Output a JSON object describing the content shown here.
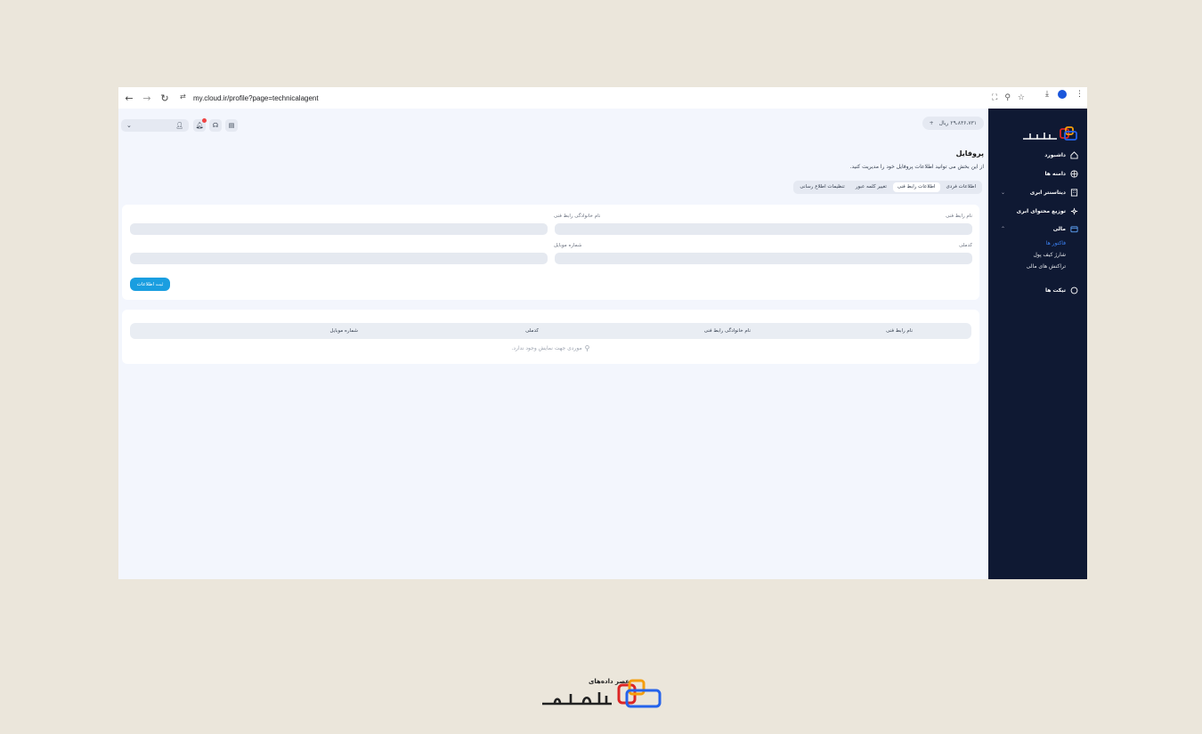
{
  "browser": {
    "url": "my.cloud.ir/profile?page=technicalagent"
  },
  "sidebar": {
    "items": [
      {
        "label": "داشبورد",
        "icon": "home-icon"
      },
      {
        "label": "دامنه ها",
        "icon": "globe-icon"
      },
      {
        "label": "دیتاسنتر ابری",
        "icon": "building-icon"
      },
      {
        "label": "توزیع محتوای ابری",
        "icon": "cdn-icon"
      },
      {
        "label": "مالی",
        "icon": "wallet-icon"
      },
      {
        "label": "تیکت ها",
        "icon": "chat-icon"
      }
    ],
    "finance_sub": [
      "فاکتور ها",
      "شارژ کیف پول",
      "تراکنش های مالی"
    ]
  },
  "header": {
    "balance": "۲۹،۸۳۶،۷۳۱ ریال",
    "balance_plus": "+"
  },
  "page": {
    "title": "پروفایل",
    "subtitle": "از این بخش می توانید اطلاعات پروفایل خود را مدیریت کنید."
  },
  "tabs": [
    "اطلاعات فردی",
    "اطلاعات رابط فنی",
    "تغییر کلمه عبور",
    "تنظیمات اطلاع رسانی"
  ],
  "form": {
    "first_name_label": "نام رابط فنی",
    "last_name_label": "نام خانوادگی رابط فنی",
    "national_code_label": "کدملی",
    "mobile_label": "شماره موبایل",
    "submit_label": "ثبت اطلاعات"
  },
  "table": {
    "headers": [
      "نام رابط فنی",
      "نام خانوادگی رابط فنی",
      "کدملی",
      "شماره موبایل"
    ],
    "empty_text": "موردی جهت نمایش وجود ندارد."
  },
  "footer": {
    "tagline": "عصر داده‌های"
  },
  "colors": {
    "sidebar_bg": "#0f1933",
    "accent": "#1a9ee0",
    "active_sub": "#3b82f6",
    "logo_orange": "#f59e0b",
    "logo_red": "#dc2626",
    "logo_blue": "#2563eb"
  }
}
